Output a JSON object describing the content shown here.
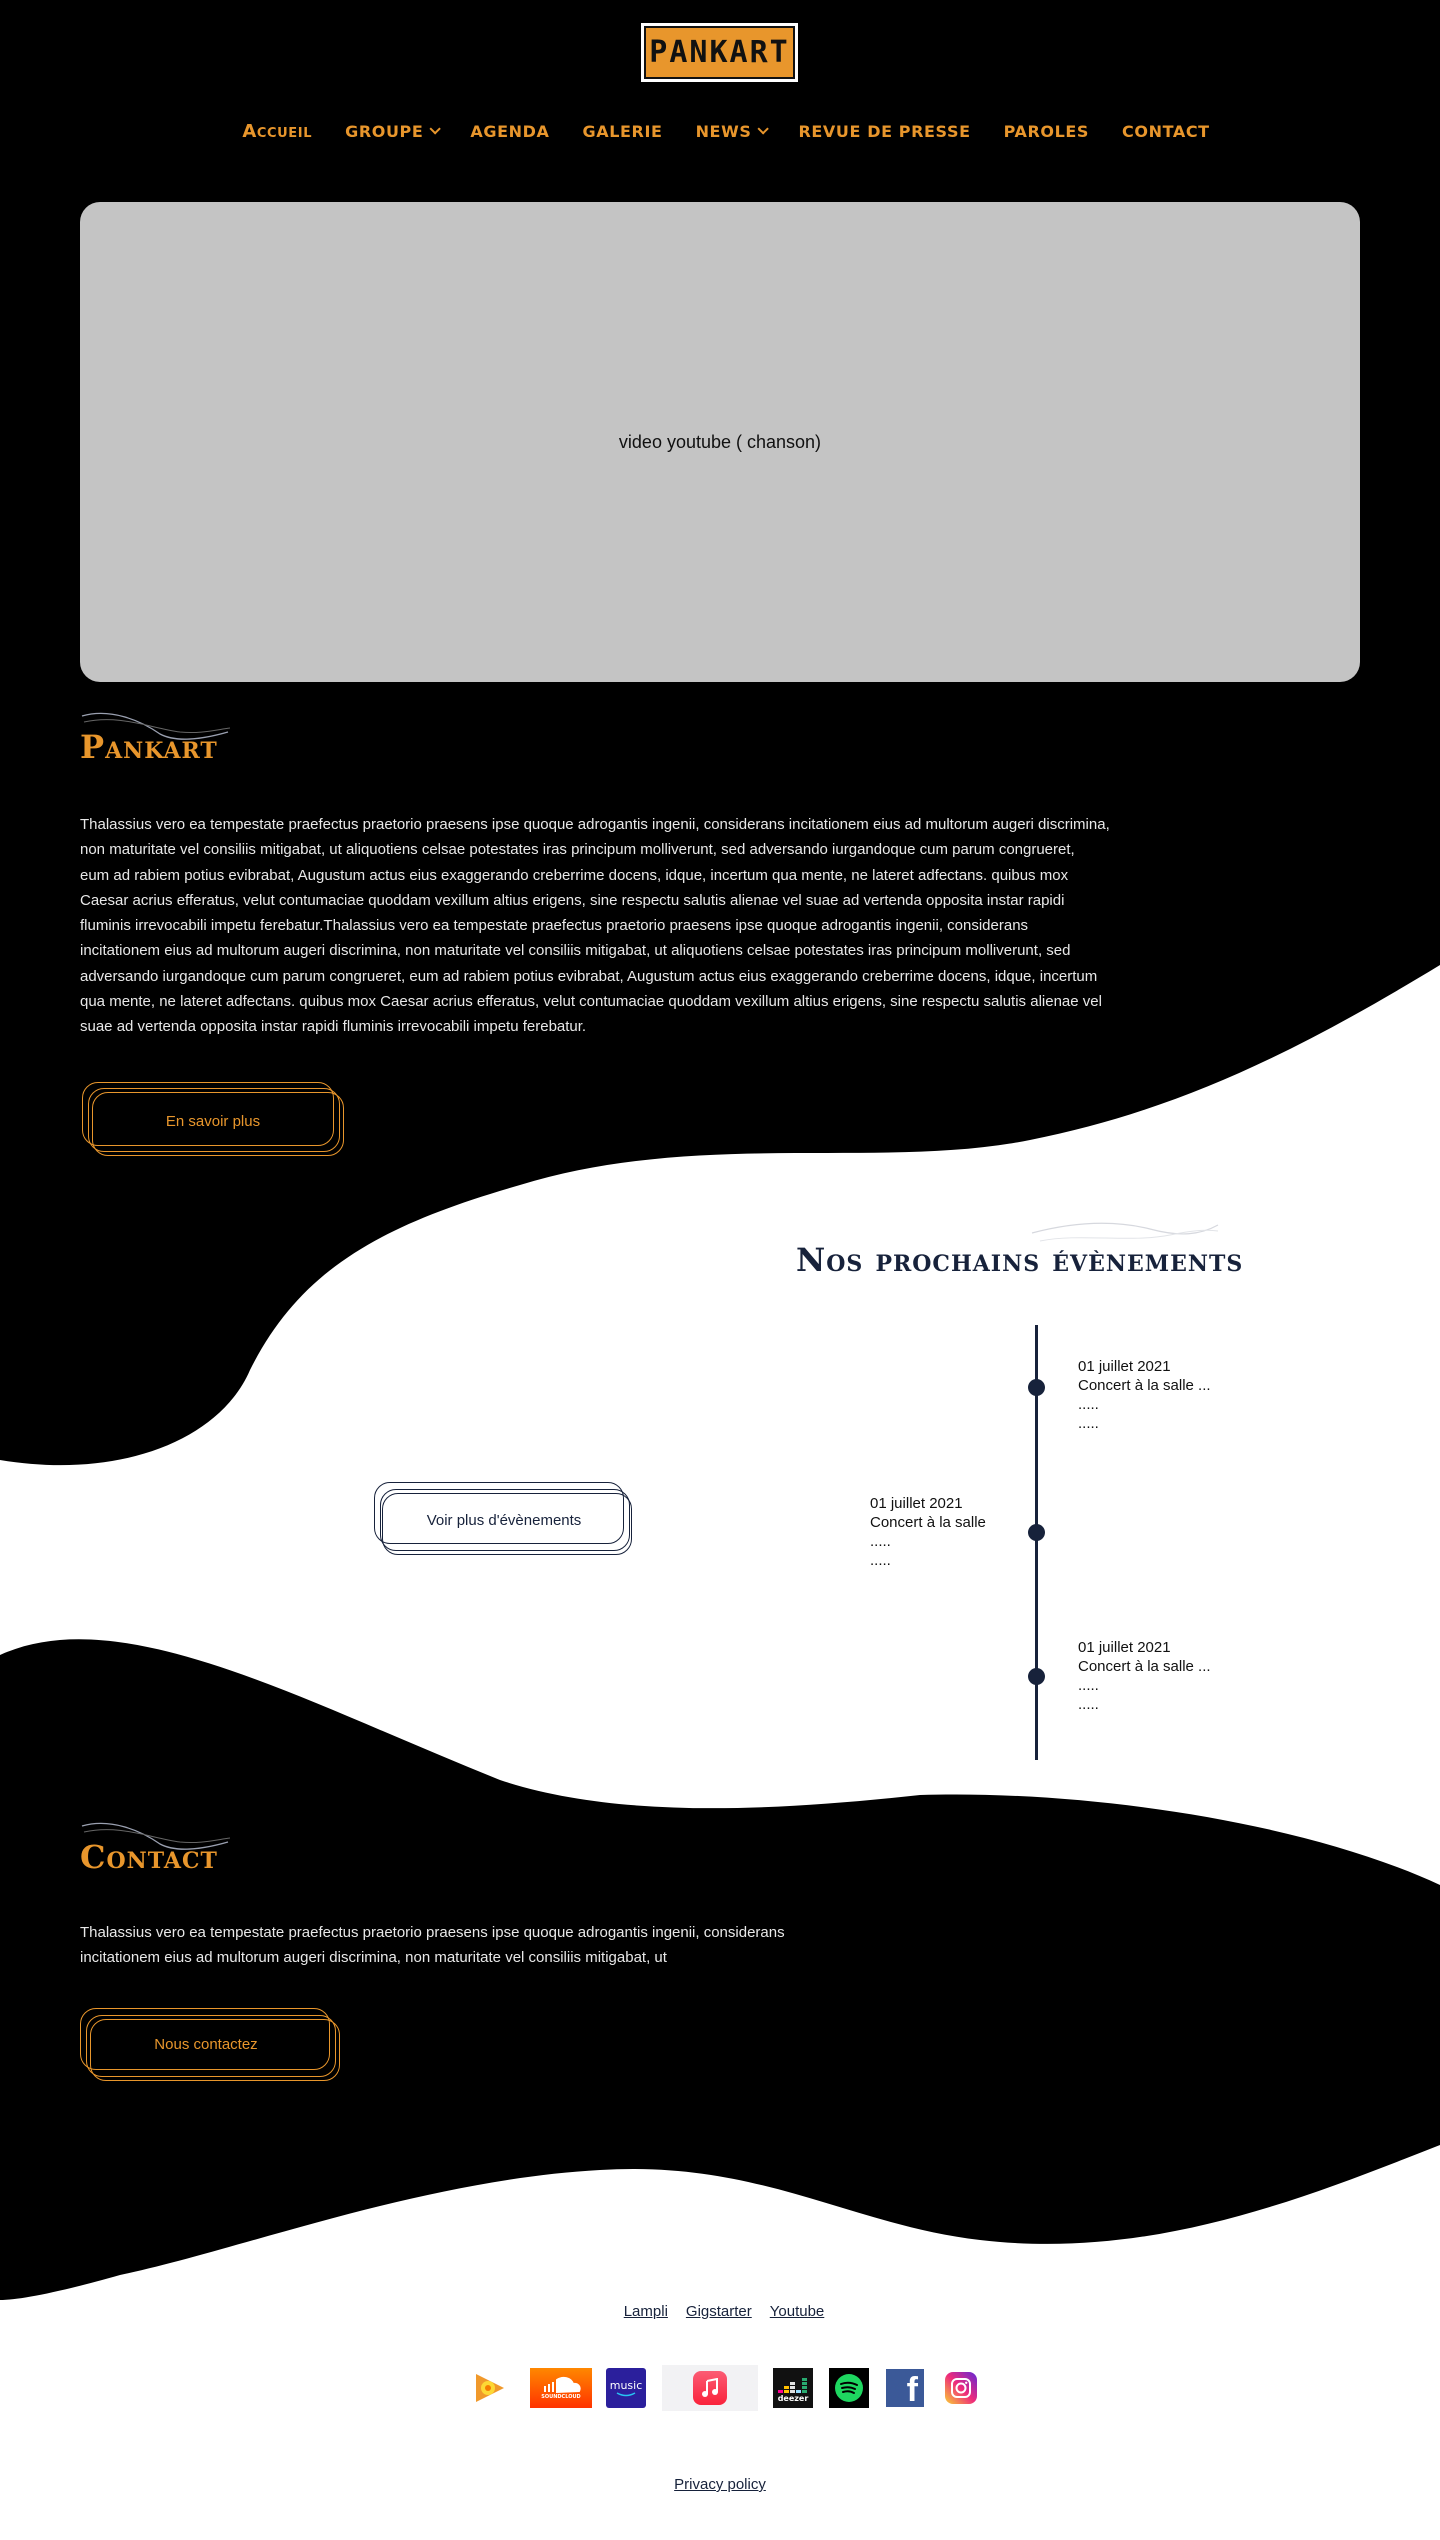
{
  "logo": {
    "text": "PANKART"
  },
  "nav": {
    "items": [
      {
        "label": "Accueil",
        "dropdown": false
      },
      {
        "label": "Groupe",
        "dropdown": true
      },
      {
        "label": "Agenda",
        "dropdown": false
      },
      {
        "label": "Galerie",
        "dropdown": false
      },
      {
        "label": "News",
        "dropdown": true
      },
      {
        "label": "Revue de presse",
        "dropdown": false
      },
      {
        "label": "Paroles",
        "dropdown": false
      },
      {
        "label": "Contact",
        "dropdown": false
      }
    ]
  },
  "video": {
    "label": "video youtube ( chanson)"
  },
  "about": {
    "title": "Pankart",
    "lines": [
      "Thalassius vero ea tempestate praefectus praetorio praesens ipse quoque adrogantis ingenii, considerans incitationem eius ad multorum augeri discrimina,",
      "non maturitate vel consiliis mitigabat, ut aliquotiens celsae potestates iras principum molliverunt, sed adversando iurgandoque cum parum congrueret,",
      "eum ad rabiem potius evibrabat, Augustum actus eius exaggerando creberrime docens, idque, incertum qua mente, ne lateret adfectans. quibus mox",
      "Caesar acrius efferatus, velut contumaciae quoddam vexillum altius erigens, sine respectu salutis alienae vel suae ad vertenda opposita instar rapidi",
      "fluminis irrevocabili impetu ferebatur.Thalassius vero ea tempestate praefectus praetorio praesens ipse quoque adrogantis ingenii, considerans",
      "incitationem eius ad multorum augeri discrimina, non maturitate vel consiliis mitigabat, ut aliquotiens celsae potestates iras principum molliverunt, sed",
      "adversando iurgandoque cum parum congrueret, eum ad rabiem potius evibrabat, Augustum actus eius exaggerando creberrime docens, idque, incertum",
      "qua mente, ne lateret adfectans. quibus mox Caesar acrius efferatus, velut contumaciae quoddam vexillum altius erigens, sine respectu salutis alienae vel",
      "suae ad vertenda opposita instar rapidi fluminis irrevocabili impetu ferebatur."
    ],
    "button": "En savoir plus"
  },
  "events": {
    "title": "Nos prochains évènements",
    "button": "Voir plus d'évènements",
    "items": [
      {
        "date": "01 juillet 2021",
        "place": "Concert à la salle ...",
        "l3": ".....",
        "l4": "....."
      },
      {
        "date": "01 juillet 2021",
        "place": "Concert à la salle",
        "l3": ".....",
        "l4": "....."
      },
      {
        "date": "01 juillet 2021",
        "place": "Concert à la salle ...",
        "l3": ".....",
        "l4": "....."
      }
    ]
  },
  "contact": {
    "title": "Contact",
    "lines": [
      "Thalassius vero ea tempestate praefectus praetorio praesens ipse quoque adrogantis ingenii, considerans",
      "incitationem eius ad multorum augeri discrimina, non maturitate vel consiliis mitigabat, ut"
    ],
    "button": "Nous contactez"
  },
  "footer": {
    "links": [
      "Lampli",
      "Gigstarter",
      "Youtube"
    ],
    "socials": {
      "google_play_music": "google-play-music-icon",
      "soundcloud": "SOUNDCLOUD",
      "amazon_music": "music",
      "apple_music": "apple-music-icon",
      "deezer": "deezer",
      "spotify": "spotify-icon",
      "facebook": "f",
      "instagram": "instagram-icon"
    },
    "privacy": "Privacy policy"
  },
  "colors": {
    "accent": "#e8962c",
    "navy": "#17223b",
    "black": "#000000",
    "video": "#c4c4c4"
  }
}
